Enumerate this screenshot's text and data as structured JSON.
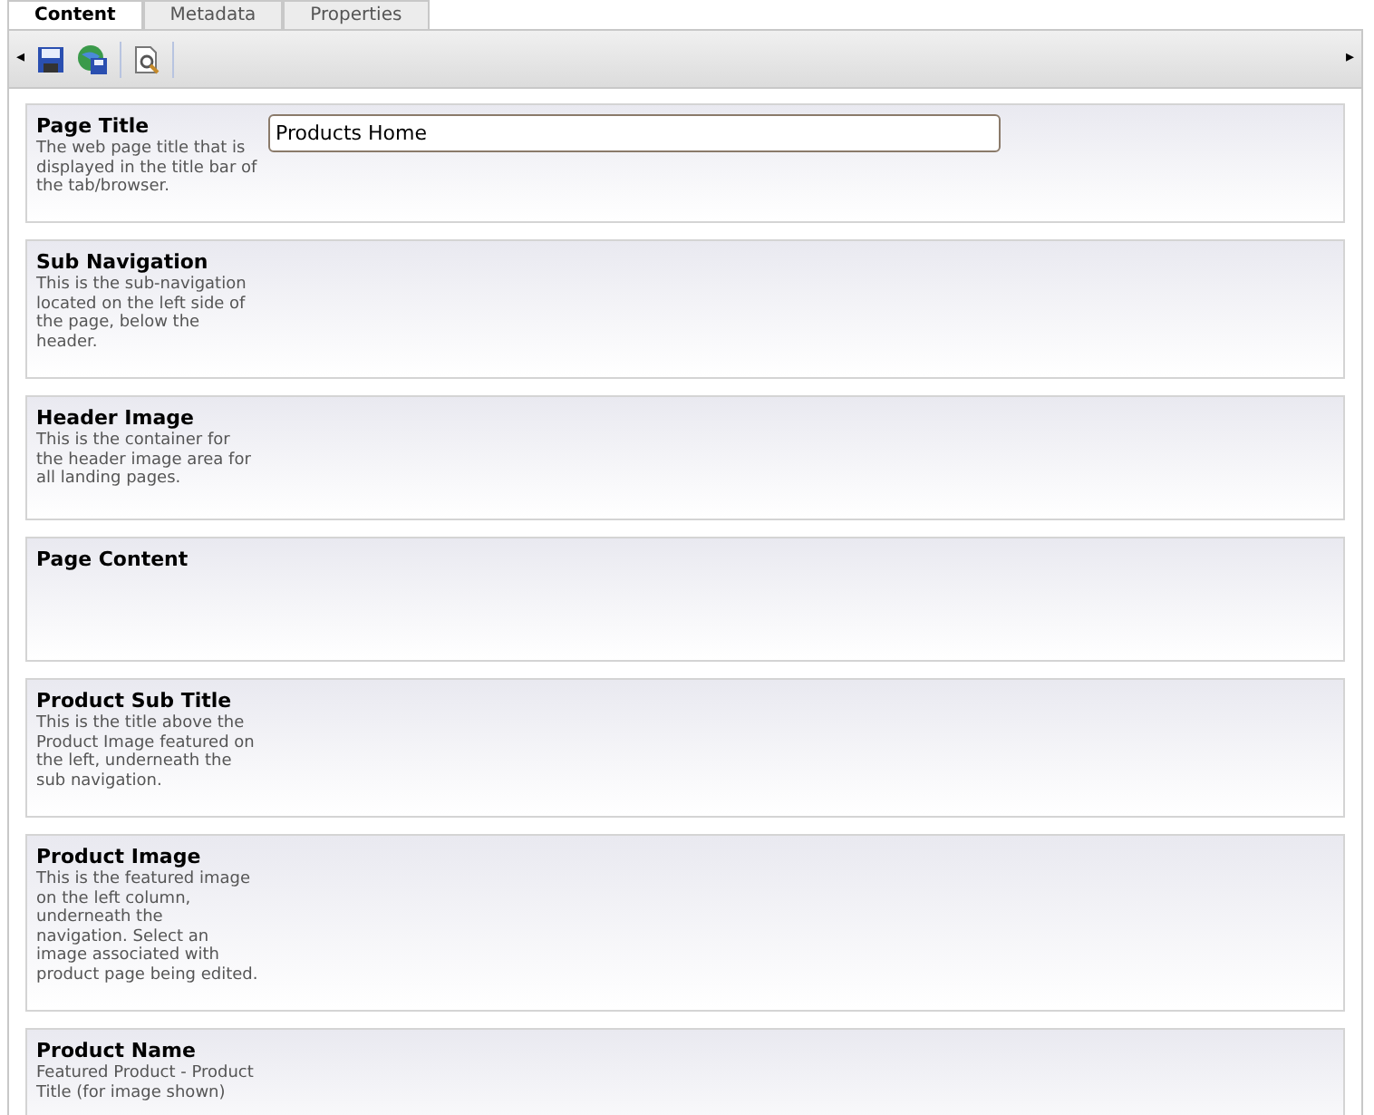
{
  "tabs": [
    {
      "label": "Content",
      "selected": true
    },
    {
      "label": "Metadata",
      "selected": false
    },
    {
      "label": "Properties",
      "selected": false
    }
  ],
  "toolbar": {
    "scroll_left": "◂",
    "scroll_right": "▸"
  },
  "fields": [
    {
      "title": "Page Title",
      "description": "The web page title that is displayed in the title bar of the tab/browser.",
      "value": "Products Home",
      "kind": "text"
    },
    {
      "title": "Sub Navigation",
      "description": "This is the sub-navigation located on the left side of the page, below the header.",
      "kind": "empty"
    },
    {
      "title": "Header Image",
      "description": "This is the container for the header image area for all landing pages.",
      "kind": "empty"
    },
    {
      "title": "Page Content",
      "kind": "empty"
    },
    {
      "title": "Product Sub Title",
      "description": "This is the title above the Product Image featured on the left, underneath the sub navigation.",
      "kind": "empty"
    },
    {
      "title": "Product Image",
      "description": "This is the featured image on the left column, underneath the navigation. Select an image associated with product page being edited.",
      "kind": "empty"
    },
    {
      "title": "Product Name",
      "description": "Featured Product - Product Title (for image shown)",
      "kind": "empty"
    }
  ]
}
